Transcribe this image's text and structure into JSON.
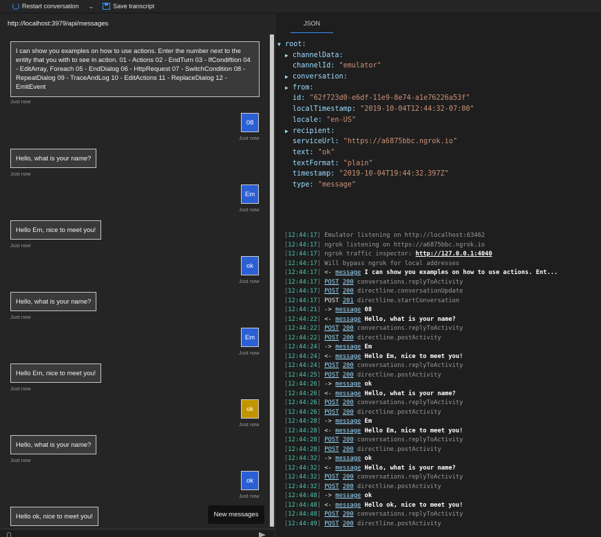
{
  "toolbar": {
    "restart_label": "Restart conversation",
    "save_label": "Save transcript"
  },
  "chat": {
    "endpoint": "http://localhost:3979/api/messages",
    "new_messages_label": "New messages",
    "intro_text": "I can show you examples on how to use actions. Enter the number next to the entity that you with to see in action. 01 - Actions 02 - EndTurn 03 - IfCondiftion 04 - EditArray, Foreach 05 - EndDialog 06 - HttpRequest 07 - SwitchCondition 08 - RepeatDialog 09 - TraceAndLog 10 - EditActions 11 - ReplaceDialog 12 - EmitEvent",
    "timestamp": "Just now",
    "messages": [
      {
        "from": "user",
        "text": "08"
      },
      {
        "from": "bot",
        "text": "Hello, what is your name?"
      },
      {
        "from": "user",
        "text": "Em"
      },
      {
        "from": "bot",
        "text": "Hello Em, nice to meet you!"
      },
      {
        "from": "user",
        "text": "ok"
      },
      {
        "from": "bot",
        "text": "Hello, what is your name?"
      },
      {
        "from": "user",
        "text": "Em"
      },
      {
        "from": "bot",
        "text": "Hello Em, nice to meet you!"
      },
      {
        "from": "user",
        "text": "ok",
        "selected": true
      },
      {
        "from": "bot",
        "text": "Hello, what is your name?"
      },
      {
        "from": "user",
        "text": "ok"
      },
      {
        "from": "bot",
        "text": "Hello ok, nice to meet you!"
      }
    ]
  },
  "inspector": {
    "tab_label": "JSON",
    "tree": [
      {
        "depth": 0,
        "expandable": true,
        "key": "root:",
        "value": ""
      },
      {
        "depth": 1,
        "expandable": true,
        "key": "channelData:",
        "value": ""
      },
      {
        "depth": 1,
        "expandable": false,
        "key": "channelId:",
        "value": "\"emulator\""
      },
      {
        "depth": 1,
        "expandable": true,
        "key": "conversation:",
        "value": ""
      },
      {
        "depth": 1,
        "expandable": true,
        "key": "from:",
        "value": ""
      },
      {
        "depth": 1,
        "expandable": false,
        "key": "id:",
        "value": "\"62f723d0-e6df-11e9-8e74-a1e76226a53f\""
      },
      {
        "depth": 1,
        "expandable": false,
        "key": "localTimestamp:",
        "value": "\"2019-10-04T12:44:32-07:00\""
      },
      {
        "depth": 1,
        "expandable": false,
        "key": "locale:",
        "value": "\"en-US\""
      },
      {
        "depth": 1,
        "expandable": true,
        "key": "recipient:",
        "value": ""
      },
      {
        "depth": 1,
        "expandable": false,
        "key": "serviceUrl:",
        "value": "\"https://a6875bbc.ngrok.io\""
      },
      {
        "depth": 1,
        "expandable": false,
        "key": "text:",
        "value": "\"ok\""
      },
      {
        "depth": 1,
        "expandable": false,
        "key": "textFormat:",
        "value": "\"plain\""
      },
      {
        "depth": 1,
        "expandable": false,
        "key": "timestamp:",
        "value": "\"2019-10-04T19:44:32.397Z\""
      },
      {
        "depth": 1,
        "expandable": false,
        "key": "type:",
        "value": "\"message\""
      }
    ],
    "tree_arrow": "▶",
    "tree_arrow_open": "▼"
  },
  "log": [
    {
      "time": "12:44:17",
      "parts": [
        {
          "t": "plain-dim",
          "v": "Emulator listening on http://localhost:63462"
        }
      ]
    },
    {
      "time": "12:44:17",
      "parts": [
        {
          "t": "plain-dim",
          "v": "ngrok listening on https://a6875bbc.ngrok.io"
        }
      ]
    },
    {
      "time": "12:44:17",
      "parts": [
        {
          "t": "plain-dim",
          "v": "ngrok traffic inspector: "
        },
        {
          "t": "link-bold",
          "v": "http://127.0.0.1:4040"
        }
      ]
    },
    {
      "time": "12:44:17",
      "parts": [
        {
          "t": "plain-dim",
          "v": "Will bypass ngrok for local addresses"
        }
      ]
    },
    {
      "time": "12:44:17",
      "parts": [
        {
          "t": "white",
          "v": "<- "
        },
        {
          "t": "link",
          "v": "message"
        },
        {
          "t": "bold",
          "v": " I can show you examples on how to use actions. Ent..."
        }
      ]
    },
    {
      "time": "12:44:17",
      "parts": [
        {
          "t": "link",
          "v": "POST"
        },
        {
          "t": "white",
          "v": " "
        },
        {
          "t": "link",
          "v": "200"
        },
        {
          "t": "dim",
          "v": " conversations.replyToActivity"
        }
      ]
    },
    {
      "time": "12:44:17",
      "parts": [
        {
          "t": "link",
          "v": "POST"
        },
        {
          "t": "white",
          "v": " "
        },
        {
          "t": "link",
          "v": "200"
        },
        {
          "t": "dim",
          "v": " directline.conversationUpdate"
        }
      ]
    },
    {
      "time": "12:44:17",
      "parts": [
        {
          "t": "white",
          "v": "POST "
        },
        {
          "t": "link",
          "v": "201"
        },
        {
          "t": "dim",
          "v": " directline.startConversation"
        }
      ]
    },
    {
      "time": "12:44:21",
      "parts": [
        {
          "t": "white",
          "v": "-> "
        },
        {
          "t": "link",
          "v": "message"
        },
        {
          "t": "bold",
          "v": " 08"
        }
      ]
    },
    {
      "time": "12:44:22",
      "parts": [
        {
          "t": "white",
          "v": "<- "
        },
        {
          "t": "link",
          "v": "message"
        },
        {
          "t": "bold",
          "v": " Hello, what is your name?"
        }
      ]
    },
    {
      "time": "12:44:22",
      "parts": [
        {
          "t": "link",
          "v": "POST"
        },
        {
          "t": "white",
          "v": " "
        },
        {
          "t": "link",
          "v": "200"
        },
        {
          "t": "dim",
          "v": " conversations.replyToActivity"
        }
      ]
    },
    {
      "time": "12:44:22",
      "parts": [
        {
          "t": "link",
          "v": "POST"
        },
        {
          "t": "white",
          "v": " "
        },
        {
          "t": "link",
          "v": "200"
        },
        {
          "t": "dim",
          "v": " directline.postActivity"
        }
      ]
    },
    {
      "time": "12:44:24",
      "parts": [
        {
          "t": "white",
          "v": "-> "
        },
        {
          "t": "link",
          "v": "message"
        },
        {
          "t": "bold",
          "v": " Em"
        }
      ]
    },
    {
      "time": "12:44:24",
      "parts": [
        {
          "t": "white",
          "v": "<- "
        },
        {
          "t": "link",
          "v": "message"
        },
        {
          "t": "bold",
          "v": " Hello Em, nice to meet you!"
        }
      ]
    },
    {
      "time": "12:44:24",
      "parts": [
        {
          "t": "link",
          "v": "POST"
        },
        {
          "t": "white",
          "v": " "
        },
        {
          "t": "link",
          "v": "200"
        },
        {
          "t": "dim",
          "v": " conversations.replyToActivity"
        }
      ]
    },
    {
      "time": "12:44:25",
      "parts": [
        {
          "t": "link",
          "v": "POST"
        },
        {
          "t": "white",
          "v": " "
        },
        {
          "t": "link",
          "v": "200"
        },
        {
          "t": "dim",
          "v": " directline.postActivity"
        }
      ]
    },
    {
      "time": "12:44:26",
      "parts": [
        {
          "t": "white",
          "v": "-> "
        },
        {
          "t": "link",
          "v": "message"
        },
        {
          "t": "bold",
          "v": " ok"
        }
      ]
    },
    {
      "time": "12:44:26",
      "parts": [
        {
          "t": "white",
          "v": "<- "
        },
        {
          "t": "link",
          "v": "message"
        },
        {
          "t": "bold",
          "v": " Hello, what is your name?"
        }
      ]
    },
    {
      "time": "12:44:26",
      "parts": [
        {
          "t": "link",
          "v": "POST"
        },
        {
          "t": "white",
          "v": " "
        },
        {
          "t": "link",
          "v": "200"
        },
        {
          "t": "dim",
          "v": " conversations.replyToActivity"
        }
      ]
    },
    {
      "time": "12:44:26",
      "parts": [
        {
          "t": "link",
          "v": "POST"
        },
        {
          "t": "white",
          "v": " "
        },
        {
          "t": "link",
          "v": "200"
        },
        {
          "t": "dim",
          "v": " directline.postActivity"
        }
      ]
    },
    {
      "time": "12:44:28",
      "parts": [
        {
          "t": "white",
          "v": "-> "
        },
        {
          "t": "link",
          "v": "message"
        },
        {
          "t": "bold",
          "v": " Em"
        }
      ]
    },
    {
      "time": "12:44:28",
      "parts": [
        {
          "t": "white",
          "v": "<- "
        },
        {
          "t": "link",
          "v": "message"
        },
        {
          "t": "bold",
          "v": " Hello Em, nice to meet you!"
        }
      ]
    },
    {
      "time": "12:44:28",
      "parts": [
        {
          "t": "link",
          "v": "POST"
        },
        {
          "t": "white",
          "v": " "
        },
        {
          "t": "link",
          "v": "200"
        },
        {
          "t": "dim",
          "v": " conversations.replyToActivity"
        }
      ]
    },
    {
      "time": "12:44:28",
      "parts": [
        {
          "t": "link",
          "v": "POST"
        },
        {
          "t": "white",
          "v": " "
        },
        {
          "t": "link",
          "v": "200"
        },
        {
          "t": "dim",
          "v": " directline.postActivity"
        }
      ]
    },
    {
      "time": "12:44:32",
      "parts": [
        {
          "t": "white",
          "v": "-> "
        },
        {
          "t": "link",
          "v": "message"
        },
        {
          "t": "bold",
          "v": " ok"
        }
      ]
    },
    {
      "time": "12:44:32",
      "parts": [
        {
          "t": "white",
          "v": "<- "
        },
        {
          "t": "link",
          "v": "message"
        },
        {
          "t": "bold",
          "v": " Hello, what is your name?"
        }
      ]
    },
    {
      "time": "12:44:32",
      "parts": [
        {
          "t": "link",
          "v": "POST"
        },
        {
          "t": "white",
          "v": " "
        },
        {
          "t": "link",
          "v": "200"
        },
        {
          "t": "dim",
          "v": " conversations.replyToActivity"
        }
      ]
    },
    {
      "time": "12:44:32",
      "parts": [
        {
          "t": "link",
          "v": "POST"
        },
        {
          "t": "white",
          "v": " "
        },
        {
          "t": "link",
          "v": "200"
        },
        {
          "t": "dim",
          "v": " directline.postActivity"
        }
      ]
    },
    {
      "time": "12:44:48",
      "parts": [
        {
          "t": "white",
          "v": "-> "
        },
        {
          "t": "link",
          "v": "message"
        },
        {
          "t": "bold",
          "v": " ok"
        }
      ]
    },
    {
      "time": "12:44:48",
      "parts": [
        {
          "t": "white",
          "v": "<- "
        },
        {
          "t": "link",
          "v": "message"
        },
        {
          "t": "bold",
          "v": " Hello ok, nice to meet you!"
        }
      ]
    },
    {
      "time": "12:44:48",
      "parts": [
        {
          "t": "link",
          "v": "POST"
        },
        {
          "t": "white",
          "v": " "
        },
        {
          "t": "link",
          "v": "200"
        },
        {
          "t": "dim",
          "v": " conversations.replyToActivity"
        }
      ]
    },
    {
      "time": "12:44:49",
      "parts": [
        {
          "t": "link",
          "v": "POST"
        },
        {
          "t": "white",
          "v": " "
        },
        {
          "t": "link",
          "v": "200"
        },
        {
          "t": "dim",
          "v": " directline.postActivity"
        }
      ]
    }
  ],
  "colors": {
    "user_bubble": "#2b5fd4",
    "user_bubble_selected": "#c29400",
    "accent": "#3794ff"
  }
}
